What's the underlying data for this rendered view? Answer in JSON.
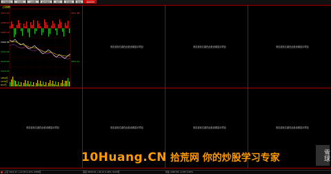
{
  "toolbar": {
    "tabs": [
      {
        "label": "行情报价"
      },
      {
        "label": "分时图"
      },
      {
        "label": "K线图"
      },
      {
        "label": "综合排名"
      },
      {
        "label": "资讯"
      },
      {
        "label": "自选股"
      },
      {
        "label": "板块"
      },
      {
        "label": "多股同列"
      }
    ],
    "colors": {
      "active": "#b00000",
      "button": "#d4d0c8"
    }
  },
  "chart_panel": {
    "header": "上证指数",
    "price_labels": [
      "3012.47",
      "2998.10",
      "2983.73",
      "2969.36",
      "2954.99",
      "2940.62",
      "2926.25",
      "2911.88",
      "2897.51"
    ],
    "volume_labels": [
      "1850万",
      "1230万",
      "615万"
    ],
    "time_labels": [
      "09:30",
      "10:30",
      "13:00",
      "14:00",
      "15:00"
    ]
  },
  "placeholders": {
    "text": "双击鼠标左键在此处设置显示项目",
    "count": 7
  },
  "banner": {
    "brand": "10Huang.CN",
    "slogan": "拾荒网 你的炒股学习专家"
  },
  "watermark": {
    "text": "雪球"
  },
  "statusbar": {
    "left": "上证 3012.47 +12.35 0.41% 2356亿",
    "middle": "深证 9876.54 +45.21 0.46% 3120亿",
    "right": "创业 1987.65 +9.87 0.50%"
  }
}
